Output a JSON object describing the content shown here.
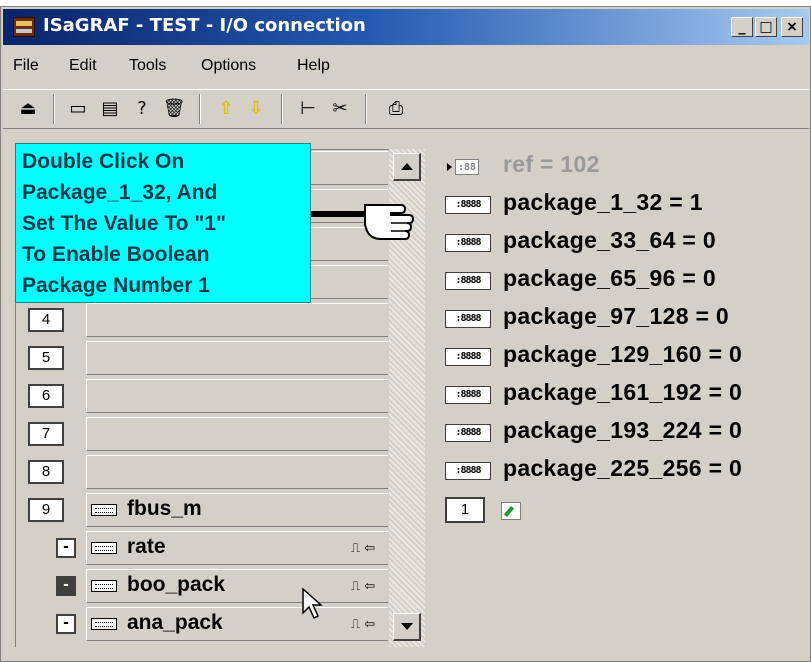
{
  "window": {
    "title": "ISaGRAF - TEST - I/O connection",
    "controls": {
      "minimize": "_",
      "maximize": "□",
      "close": "×"
    }
  },
  "menu": [
    "File",
    "Edit",
    "Tools",
    "Options",
    "Help"
  ],
  "toolbar": {
    "buttons": [
      {
        "icon": "open-board-icon"
      },
      {
        "icon": "connect-board-icon"
      },
      {
        "icon": "board-properties-icon"
      },
      {
        "icon": "help-query-icon"
      },
      {
        "icon": "delete-icon"
      },
      {
        "icon": "arrow-up-icon"
      },
      {
        "icon": "arrow-down-icon"
      },
      {
        "icon": "hierarchy-icon"
      },
      {
        "icon": "cut-icon"
      },
      {
        "icon": "print-icon"
      }
    ]
  },
  "annotation": {
    "lines": [
      "Double Click On",
      "Package_1_32, And",
      "Set The Value To \"1\"",
      "To Enable Boolean",
      "Package Number 1"
    ],
    "color": "#00ffff"
  },
  "slots": [
    {
      "num": "4",
      "label": ""
    },
    {
      "num": "5",
      "label": ""
    },
    {
      "num": "6",
      "label": ""
    },
    {
      "num": "7",
      "label": ""
    },
    {
      "num": "8",
      "label": ""
    },
    {
      "num": "9",
      "label": "fbus_m"
    }
  ],
  "subitems": [
    {
      "toggle": "-",
      "label": "rate",
      "selected": false
    },
    {
      "toggle": "-",
      "label": "boo_pack",
      "selected": true
    },
    {
      "toggle": "-",
      "label": "ana_pack",
      "selected": false
    }
  ],
  "variables": {
    "ref": "ref = 102",
    "ref_icon_text": ":88",
    "icon_text": ":8888",
    "items": [
      "package_1_32 = 1",
      "package_33_64 = 0",
      "package_65_96 = 0",
      "package_97_128 = 0",
      "package_129_160 = 0",
      "package_161_192 = 0",
      "package_193_224 = 0",
      "package_225_256 = 0"
    ],
    "channel_num": "1"
  }
}
